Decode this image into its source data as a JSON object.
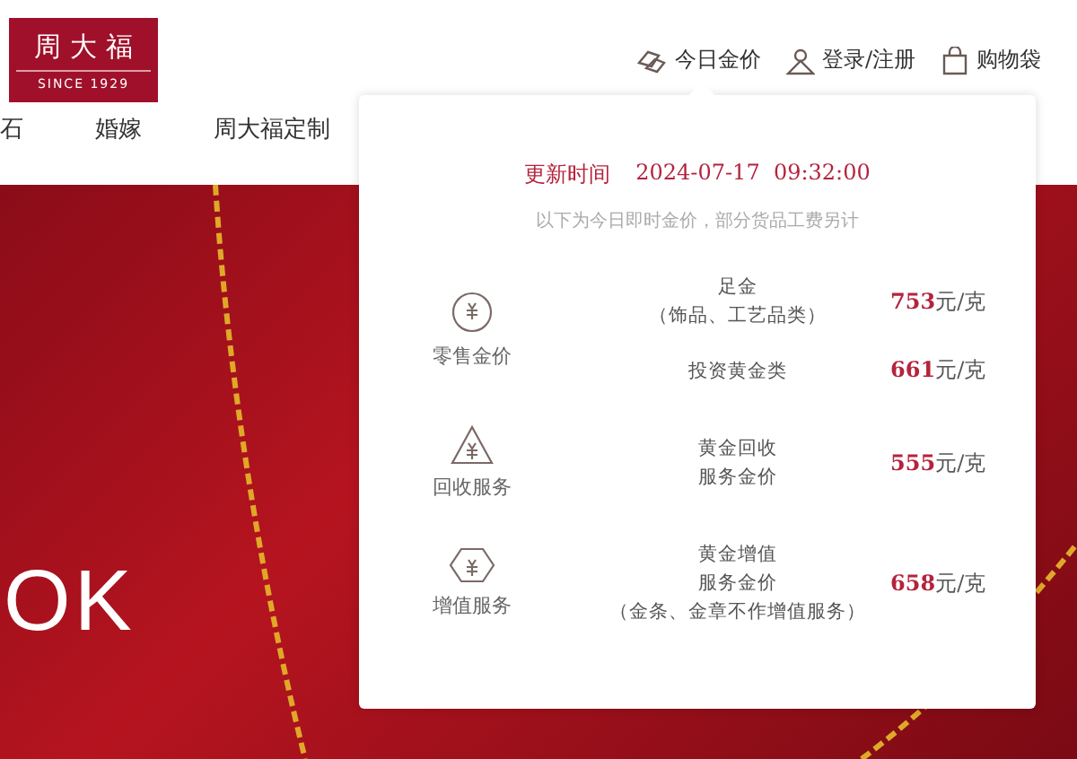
{
  "logo": {
    "brand": "周大福",
    "tagline": "SINCE 1929"
  },
  "top_links": [
    {
      "kind": "gold",
      "label": "今日金价"
    },
    {
      "kind": "user",
      "label": "登录/注册"
    },
    {
      "kind": "bag",
      "label": "购物袋"
    }
  ],
  "nav": [
    "石",
    "婚嫁",
    "周大福定制"
  ],
  "banner": {
    "text": "OK"
  },
  "gold_price_popup": {
    "update_label": "更新时间",
    "update_time": "2024-07-17  09:32:00",
    "note": "以下为今日即时金价，部分货品工费另计",
    "groups": [
      {
        "kind": "retail",
        "label": "零售金价",
        "items": [
          {
            "name": [
              "足金",
              "（饰品、工艺品类）"
            ],
            "price": "753",
            "unit": "元/克"
          },
          {
            "name": [
              "投资黄金类"
            ],
            "price": "661",
            "unit": "元/克"
          }
        ]
      },
      {
        "kind": "recycle",
        "label": "回收服务",
        "items": [
          {
            "name": [
              "黄金回收",
              "服务金价"
            ],
            "price": "555",
            "unit": "元/克"
          }
        ]
      },
      {
        "kind": "value",
        "label": "增值服务",
        "items": [
          {
            "name": [
              "黄金增值",
              "服务金价",
              "（金条、金章不作增值服务）"
            ],
            "price": "658",
            "unit": "元/克"
          }
        ]
      }
    ]
  }
}
